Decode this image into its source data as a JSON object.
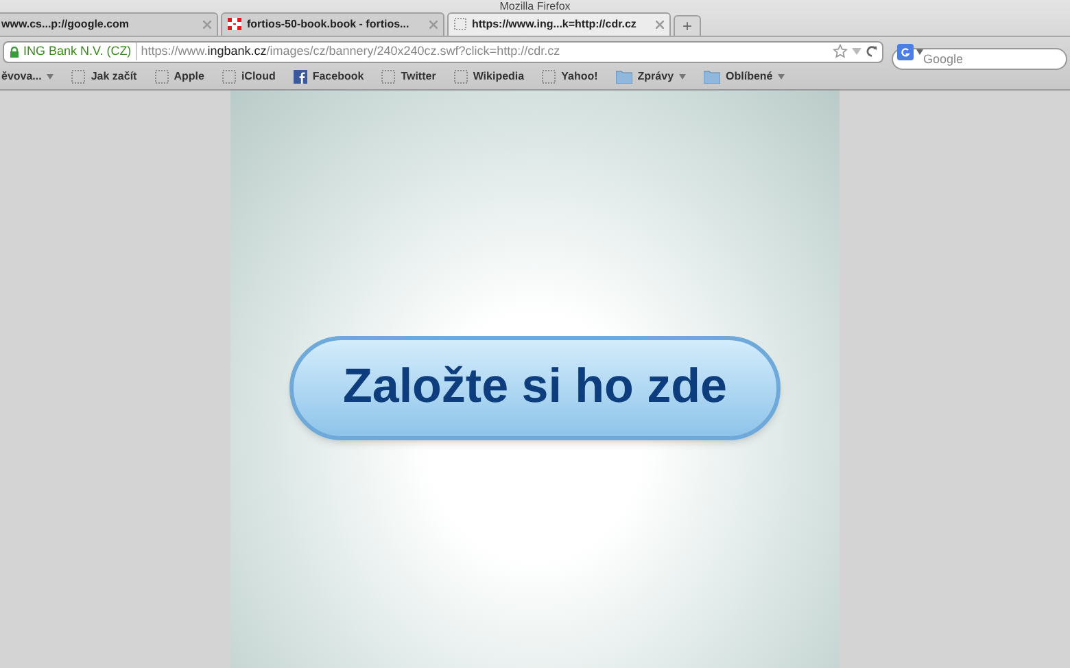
{
  "window": {
    "title": "Mozilla Firefox"
  },
  "tabs": [
    {
      "label": "www.cs...p://google.com",
      "kind": "plain",
      "selected": false
    },
    {
      "label": "fortios-50-book.book - fortios...",
      "kind": "logo",
      "selected": false
    },
    {
      "label": "https://www.ing...k=http://cdr.cz",
      "kind": "blank",
      "selected": true
    }
  ],
  "new_tab": "+",
  "address_bar": {
    "identity": "ING Bank N.V. (CZ)",
    "url_prefix": "https://www.",
    "url_domain": "ingbank.cz",
    "url_path": "/images/cz/bannery/240x240cz.swf?click=http://cdr.cz"
  },
  "search": {
    "placeholder": "Google"
  },
  "bookmarks": [
    {
      "label": "ěvova...",
      "kind": "menu"
    },
    {
      "label": "Jak začít",
      "kind": "page"
    },
    {
      "label": "Apple",
      "kind": "page"
    },
    {
      "label": "iCloud",
      "kind": "page"
    },
    {
      "label": "Facebook",
      "kind": "facebook"
    },
    {
      "label": "Twitter",
      "kind": "page"
    },
    {
      "label": "Wikipedia",
      "kind": "page"
    },
    {
      "label": "Yahoo!",
      "kind": "page"
    },
    {
      "label": "Zprávy",
      "kind": "folder"
    },
    {
      "label": "Oblíbené",
      "kind": "folder"
    }
  ],
  "banner": {
    "button": "Založte si ho zde"
  }
}
